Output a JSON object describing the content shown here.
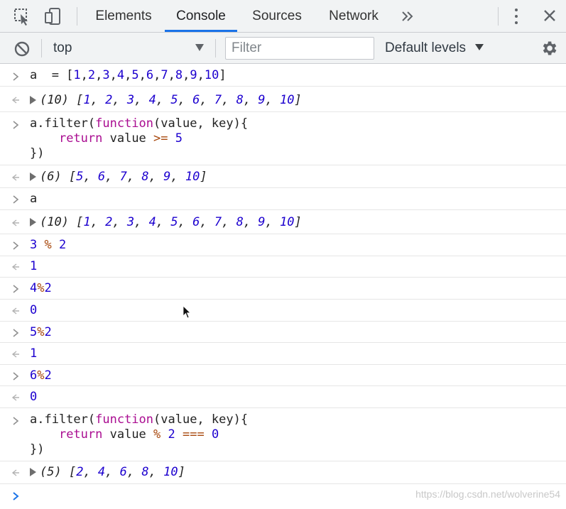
{
  "tabs": [
    {
      "label": "Elements",
      "active": false
    },
    {
      "label": "Console",
      "active": true
    },
    {
      "label": "Sources",
      "active": false
    },
    {
      "label": "Network",
      "active": false
    }
  ],
  "toolbar": {
    "context": "top",
    "filter_placeholder": "Filter",
    "filter_value": "",
    "levels": "Default levels"
  },
  "messages": [
    {
      "kind": "input",
      "lines": [
        "a  = [1,2,3,4,5,6,7,8,9,10]"
      ]
    },
    {
      "kind": "output",
      "text": "(10) [1, 2, 3, 4, 5, 6, 7, 8, 9, 10]",
      "expandable": true
    },
    {
      "kind": "input",
      "lines": [
        "a.filter(function(value, key){",
        "    return value >= 5",
        "})"
      ]
    },
    {
      "kind": "output",
      "text": "(6) [5, 6, 7, 8, 9, 10]",
      "expandable": true
    },
    {
      "kind": "input",
      "lines": [
        "a"
      ]
    },
    {
      "kind": "output",
      "text": "(10) [1, 2, 3, 4, 5, 6, 7, 8, 9, 10]",
      "expandable": true
    },
    {
      "kind": "input",
      "lines": [
        "3 % 2"
      ]
    },
    {
      "kind": "output",
      "text": "1",
      "expandable": false
    },
    {
      "kind": "input",
      "lines": [
        "4%2"
      ]
    },
    {
      "kind": "output",
      "text": "0",
      "expandable": false
    },
    {
      "kind": "input",
      "lines": [
        "5%2"
      ]
    },
    {
      "kind": "output",
      "text": "1",
      "expandable": false
    },
    {
      "kind": "input",
      "lines": [
        "6%2"
      ]
    },
    {
      "kind": "output",
      "text": "0",
      "expandable": false
    },
    {
      "kind": "input",
      "lines": [
        "a.filter(function(value, key){",
        "    return value % 2 === 0",
        "})"
      ]
    },
    {
      "kind": "output",
      "text": "(5) [2, 4, 6, 8, 10]",
      "expandable": true
    }
  ],
  "prompt": {
    "value": ""
  },
  "watermark": "https://blog.csdn.net/wolverine54",
  "colors": {
    "accent": "#1a73e8",
    "number": "#1c00cf",
    "keyword": "#aa0d91",
    "operator": "#a8480d",
    "prompt": "#1a73e8"
  },
  "icons": {
    "inspect": "inspect-element-icon",
    "device": "device-toolbar-icon",
    "more_tabs": "chevron-double-right-icon",
    "menu": "kebab-menu-icon",
    "close": "close-icon",
    "clear": "clear-console-icon",
    "dropdown": "dropdown-arrow-icon",
    "settings": "gear-icon",
    "input_prompt": "chevron-right-icon",
    "result": "result-arrow-icon",
    "expand": "expand-triangle-icon"
  }
}
